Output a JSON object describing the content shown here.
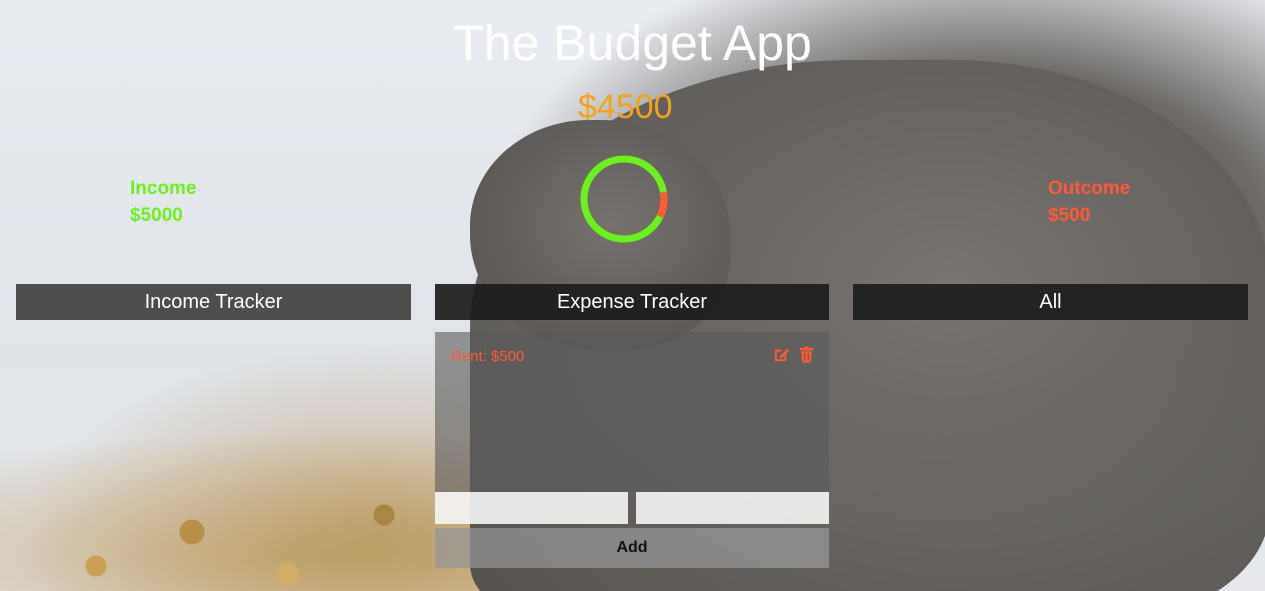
{
  "app": {
    "title": "The Budget App",
    "balance": "$4500"
  },
  "summary": {
    "income_label": "Income",
    "income_value": "$5000",
    "outcome_label": "Outcome",
    "outcome_value": "$500",
    "outcome_fraction": 0.1
  },
  "tabs": [
    {
      "label": "Income Tracker"
    },
    {
      "label": "Expense Tracker"
    },
    {
      "label": "All"
    }
  ],
  "expenses": [
    {
      "label": "Rent: $500"
    }
  ],
  "form": {
    "name_value": "",
    "amount_value": "",
    "add_label": "Add"
  },
  "colors": {
    "income": "#6cf21b",
    "outcome": "#ff5a38",
    "balance": "#f2a31b"
  },
  "icons": {
    "edit": "edit-icon",
    "delete": "trash-icon"
  }
}
